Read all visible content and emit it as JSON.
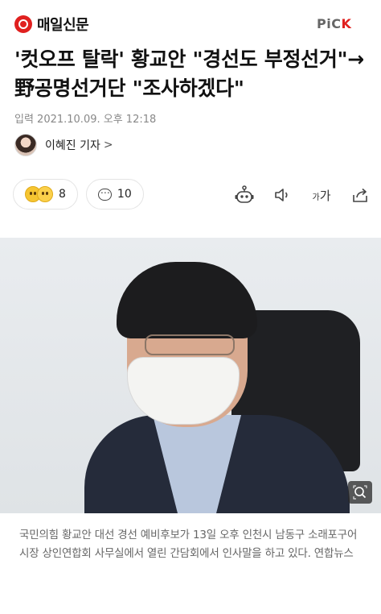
{
  "header": {
    "logo_text": "매일신문",
    "pick_prefix": "PiC",
    "pick_suffix": "K"
  },
  "article": {
    "title": "'컷오프 탈락' 황교안 \"경선도 부정선거\"→野공명선거단 \"조사하겠다\"",
    "date": "입력 2021.10.09. 오후 12:18",
    "reporter": "이혜진 기자",
    "reporter_chevron": ">",
    "reaction_count": "8",
    "comment_count": "10",
    "font_size_label_small": "가",
    "font_size_label_large": "가",
    "photo_caption": "국민의힘 황교안 대선 경선 예비후보가 13일 오후 인천시 남동구 소래포구어시장 상인연합회 사무실에서 열린 간담회에서 인사말을 하고 있다. 연합뉴스"
  },
  "icons": {
    "logo": "maeil-logo-icon",
    "reactions": "emoji-reaction-icon",
    "comment": "comment-icon",
    "bot": "robot-summary-icon",
    "tts": "speaker-icon",
    "font": "font-size-icon",
    "share": "share-icon",
    "zoom": "zoom-icon"
  },
  "colors": {
    "brand_red": "#e0201f",
    "caption_gray": "#666666"
  }
}
